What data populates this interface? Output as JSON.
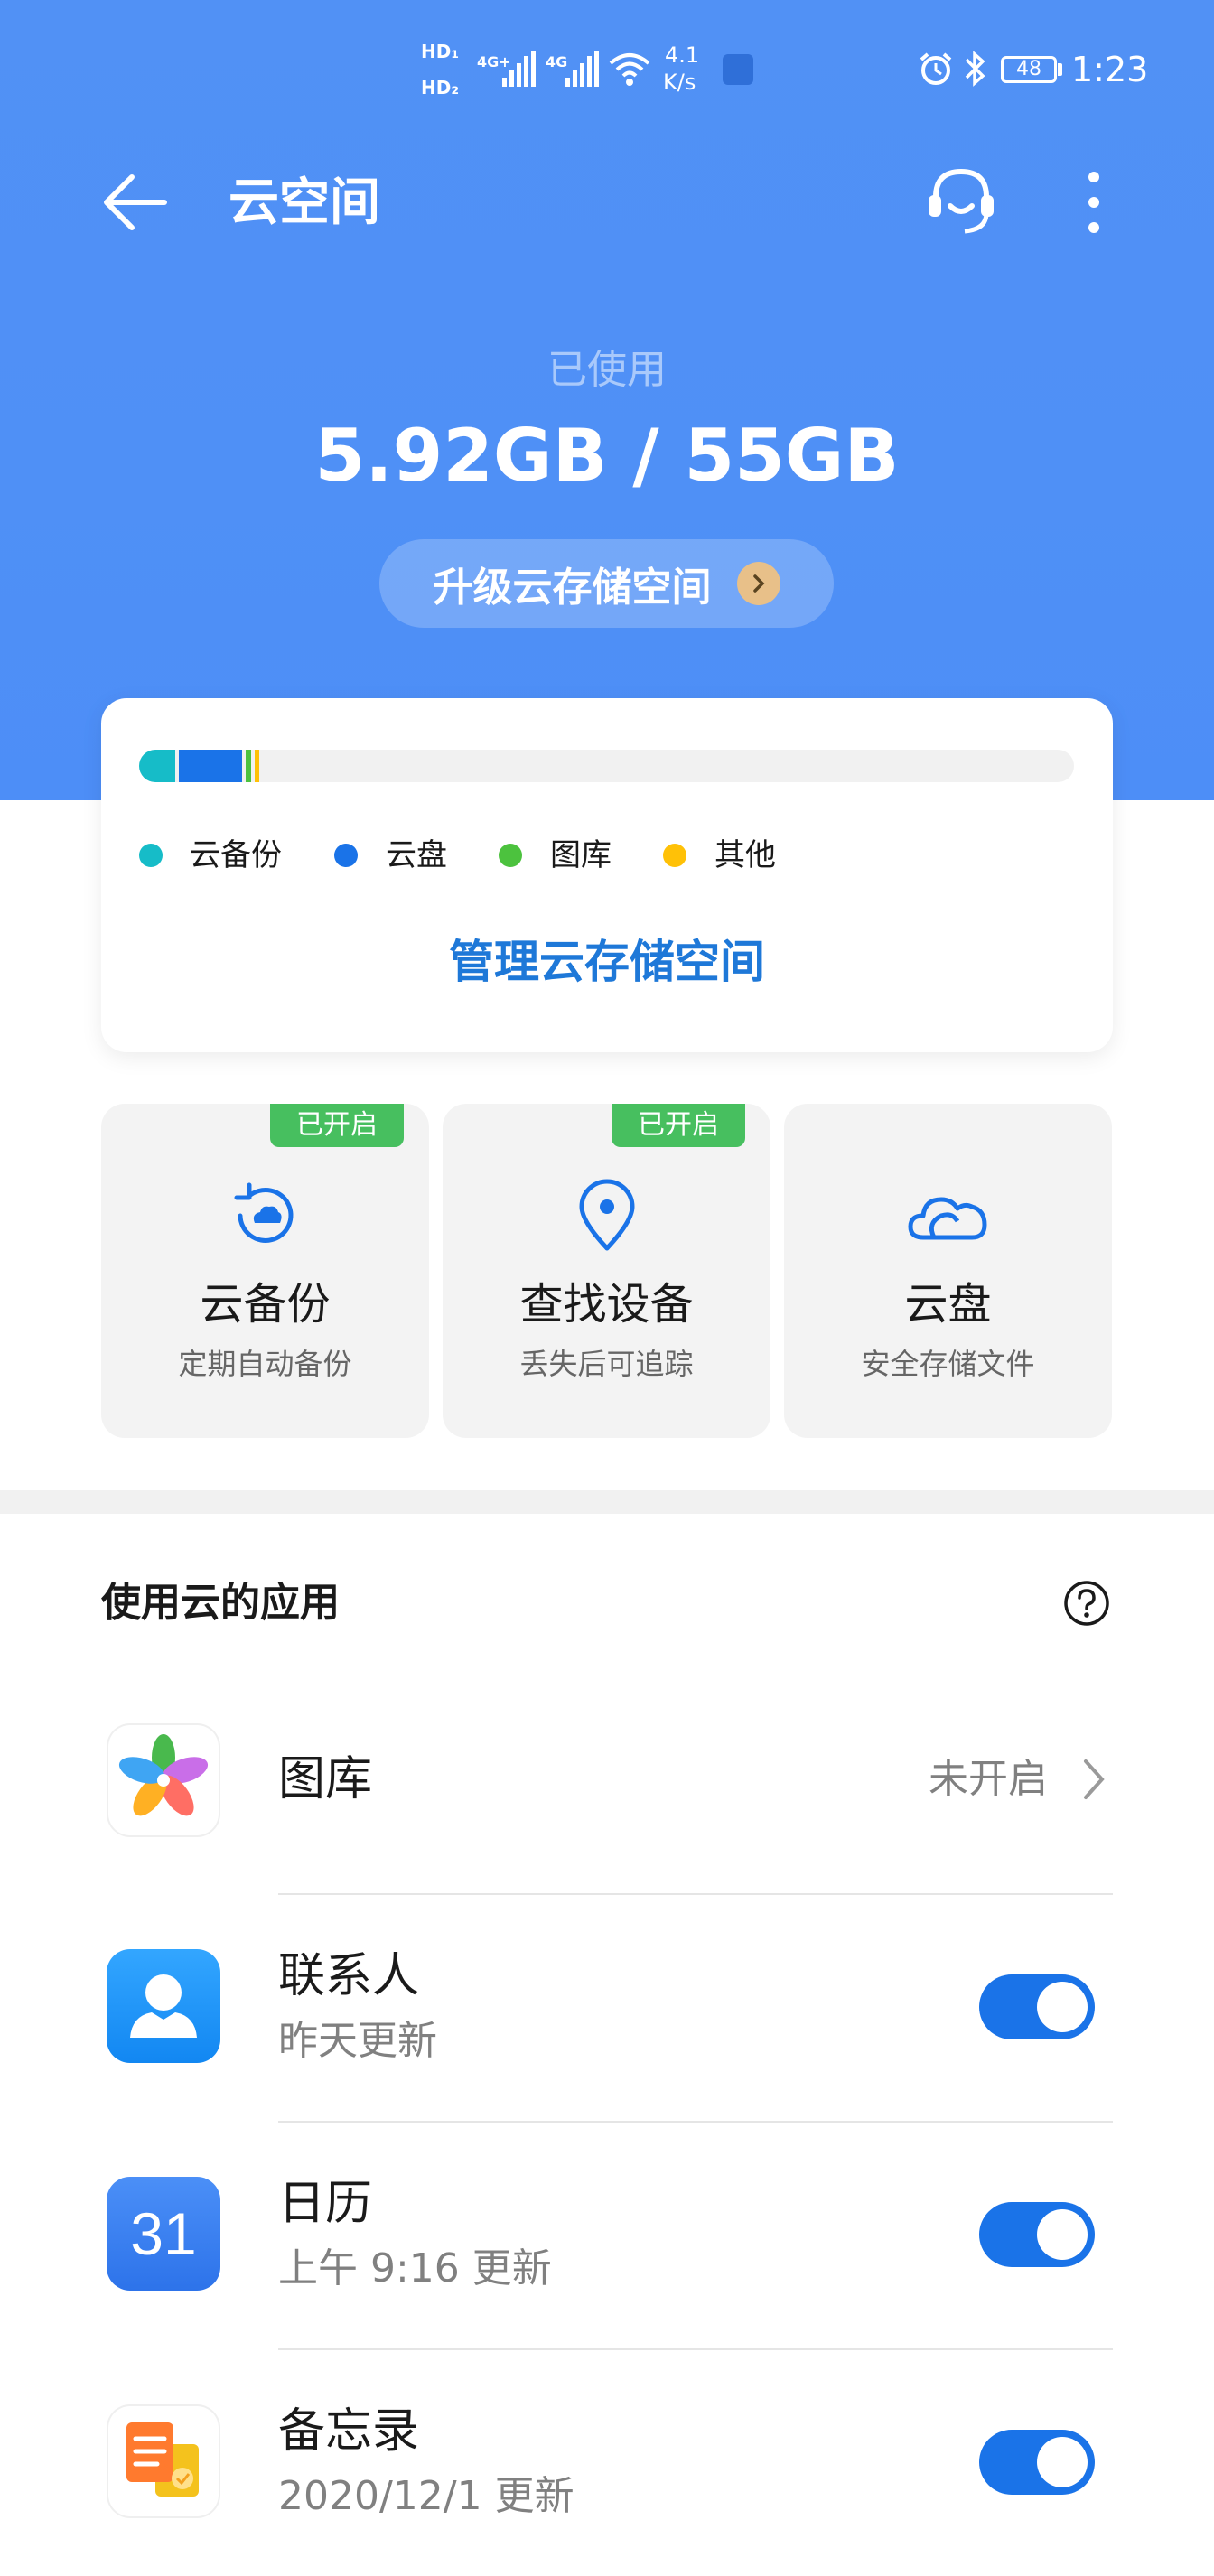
{
  "status_bar": {
    "hd1": "HD₁",
    "hd2": "HD₂",
    "sig1_label": "4G+",
    "sig2_label": "4G",
    "speed_value": "4.1",
    "speed_unit": "K/s",
    "battery": "48",
    "time": "1:23"
  },
  "app_bar": {
    "title": "云空间"
  },
  "usage": {
    "label": "已使用",
    "value": "5.92GB / 55GB",
    "upgrade_label": "升级云存储空间"
  },
  "storage": {
    "legend": [
      {
        "label": "云备份",
        "color": "#16bcc8"
      },
      {
        "label": "云盘",
        "color": "#1a73e8"
      },
      {
        "label": "图库",
        "color": "#4cc23e"
      },
      {
        "label": "其他",
        "color": "#ffc107"
      }
    ],
    "manage_label": "管理云存储空间"
  },
  "features": [
    {
      "title": "云备份",
      "subtitle": "定期自动备份",
      "badge": "已开启",
      "icon": "cloud-backup-icon"
    },
    {
      "title": "查找设备",
      "subtitle": "丢失后可追踪",
      "badge": "已开启",
      "icon": "location-pin-icon"
    },
    {
      "title": "云盘",
      "subtitle": "安全存储文件",
      "badge": "",
      "icon": "cloud-icon"
    }
  ],
  "apps_section": {
    "title": "使用云的应用",
    "items": [
      {
        "name": "图库",
        "status": "未开启",
        "subtitle": ""
      },
      {
        "name": "联系人",
        "subtitle": "昨天更新",
        "enabled": true
      },
      {
        "name": "日历",
        "subtitle": "上午 9:16 更新",
        "icon_text": "31",
        "enabled": true
      },
      {
        "name": "备忘录",
        "subtitle": "2020/12/1 更新",
        "enabled": true
      }
    ]
  }
}
